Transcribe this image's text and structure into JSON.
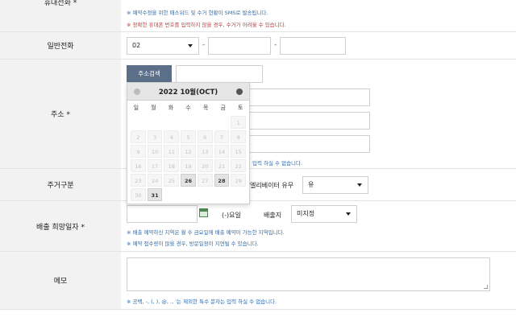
{
  "mobile": {
    "label": "휴대전화 *",
    "note_blue": "※ 예약수정을 위한 패스워드 및 수거 현황이 SMS로 발송됩니다.",
    "note_red": "※ 정확한 휴대폰 번호를 입력하지 않을 경우, 수거가 어려울 수 있습니다."
  },
  "phone": {
    "label": "일반전화",
    "area_code": "02",
    "sep": "-"
  },
  "address": {
    "label": "주소 *",
    "search_button": "주소검색",
    "note_blue": "입력 하실 수 없습니다."
  },
  "calendar": {
    "title": "2022 10월(OCT)",
    "dows": [
      "일",
      "월",
      "화",
      "수",
      "목",
      "금",
      "토"
    ],
    "weeks": [
      [
        "",
        "",
        "",
        "",
        "",
        "",
        "1"
      ],
      [
        "2",
        "3",
        "4",
        "5",
        "6",
        "7",
        "8"
      ],
      [
        "9",
        "10",
        "11",
        "12",
        "13",
        "14",
        "15"
      ],
      [
        "16",
        "17",
        "18",
        "19",
        "20",
        "21",
        "22"
      ],
      [
        "23",
        "24",
        "25",
        "26",
        "27",
        "28",
        "29"
      ],
      [
        "30",
        "31",
        "",
        "",
        "",
        "",
        ""
      ]
    ],
    "available_days": [
      "26",
      "28",
      "31"
    ]
  },
  "residence": {
    "label": "주거구분",
    "elevator_label": "엘리베이터 유무",
    "elevator_value": "유"
  },
  "pickup_date": {
    "label": "배출 희망일자 *",
    "weekday_text": "(-)요일",
    "location_label": "배출지",
    "location_value": "미지정",
    "note1": "※ 배출 예약하신 지역은 월 수 금요일에 배출 예약이 가능한 지역입니다.",
    "note2": "※ 예약 접수량이 많을 경우, 방문일정이 지연될 수 있습니다."
  },
  "memo": {
    "label": "메모",
    "note": "※ 공백, -, (, ), @, ., '는 제외한 특수 문자는 입력 하실 수 없습니다."
  }
}
